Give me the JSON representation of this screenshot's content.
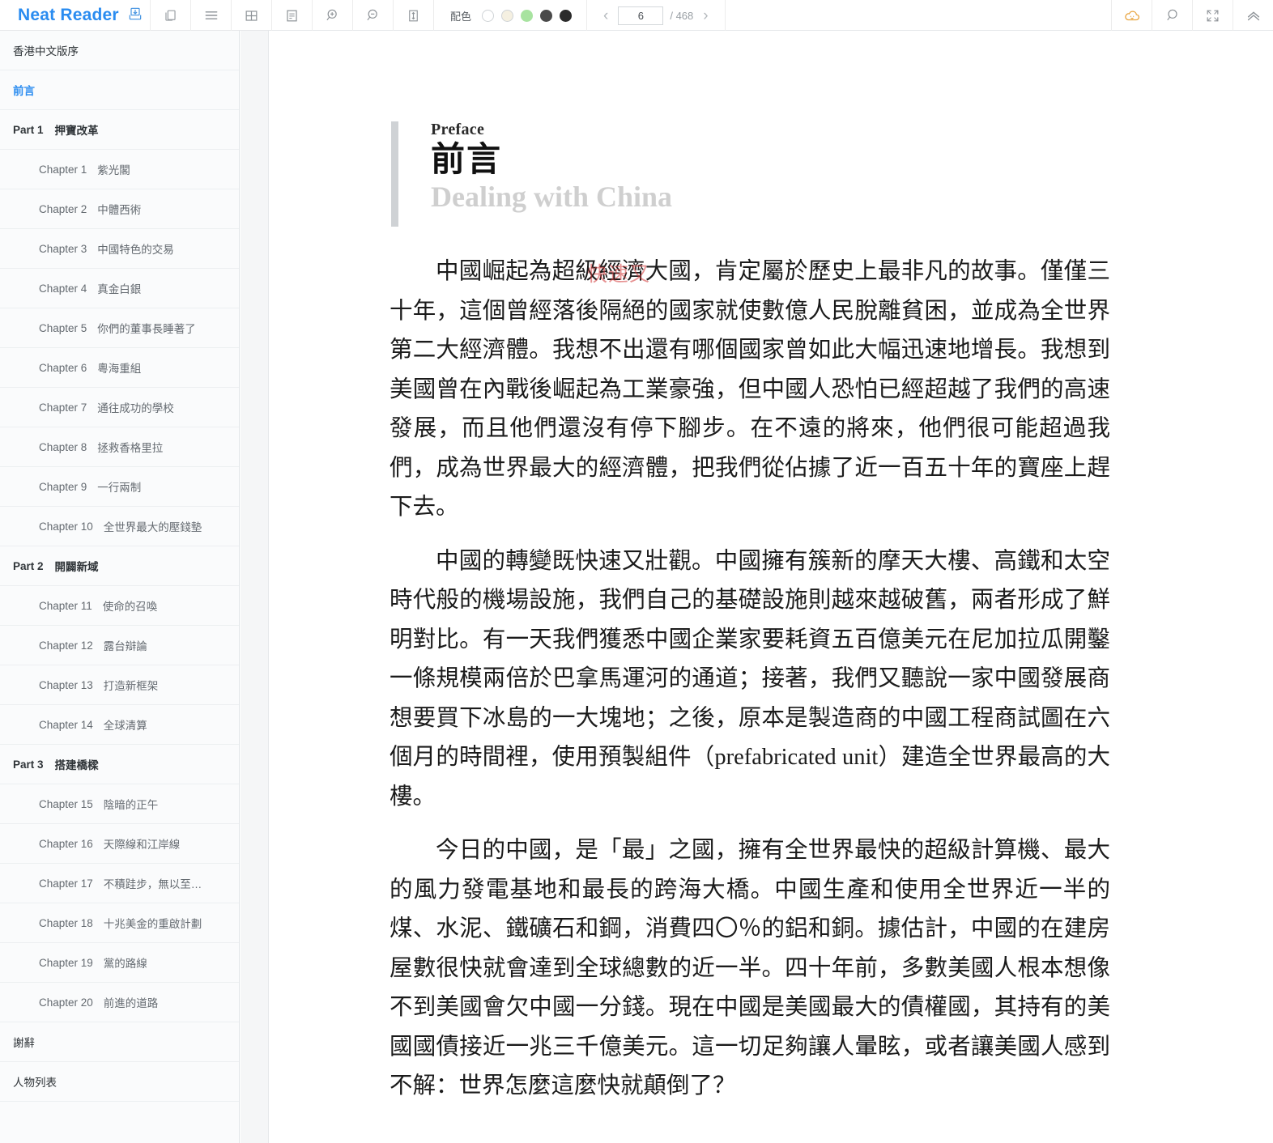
{
  "app": {
    "brand": "Neat Reader"
  },
  "toolbar": {
    "icons": [
      {
        "name": "save-book-icon",
        "glyph": "save"
      },
      {
        "name": "copy-icon",
        "glyph": "copy"
      },
      {
        "name": "menu-icon",
        "glyph": "menu"
      },
      {
        "name": "grid-icon",
        "glyph": "grid"
      },
      {
        "name": "notes-icon",
        "glyph": "notes"
      },
      {
        "name": "zoom-in-icon",
        "glyph": "zoom-in"
      },
      {
        "name": "zoom-out-icon",
        "glyph": "zoom-out"
      },
      {
        "name": "line-height-icon",
        "glyph": "line-height"
      }
    ],
    "colors_label": "配色",
    "swatches": [
      {
        "name": "theme-white",
        "hex": "#ffffff"
      },
      {
        "name": "theme-sepia",
        "hex": "#f5f0e1"
      },
      {
        "name": "theme-green",
        "hex": "#a8e3a0"
      },
      {
        "name": "theme-dark-gray",
        "hex": "#4a4a4a"
      },
      {
        "name": "theme-black",
        "hex": "#2b2b2b"
      }
    ],
    "pager": {
      "prev": "‹",
      "next": "›",
      "current_page": "6",
      "total_label": "/ 468"
    },
    "right_icons": [
      {
        "name": "cloud-sync-icon",
        "glyph": "cloud",
        "hex": "#e8a33d"
      },
      {
        "name": "search-icon",
        "glyph": "search"
      },
      {
        "name": "fullscreen-icon",
        "glyph": "fullscreen"
      },
      {
        "name": "collapse-up-icon",
        "glyph": "chevrons-up"
      }
    ]
  },
  "sidebar": {
    "items": [
      {
        "type": "front",
        "title": "香港中文版序",
        "active": false
      },
      {
        "type": "front",
        "title": "前言",
        "active": true
      },
      {
        "type": "part",
        "num": "Part 1",
        "title": "押寶改革"
      },
      {
        "type": "chapter",
        "num": "Chapter 1",
        "title": "紫光閣"
      },
      {
        "type": "chapter",
        "num": "Chapter 2",
        "title": "中體西術"
      },
      {
        "type": "chapter",
        "num": "Chapter 3",
        "title": "中國特色的交易"
      },
      {
        "type": "chapter",
        "num": "Chapter 4",
        "title": "真金白銀"
      },
      {
        "type": "chapter",
        "num": "Chapter 5",
        "title": "你們的董事長睡著了"
      },
      {
        "type": "chapter",
        "num": "Chapter 6",
        "title": "粵海重組"
      },
      {
        "type": "chapter",
        "num": "Chapter 7",
        "title": "通往成功的學校"
      },
      {
        "type": "chapter",
        "num": "Chapter 8",
        "title": "拯救香格里拉"
      },
      {
        "type": "chapter",
        "num": "Chapter 9",
        "title": "一行兩制"
      },
      {
        "type": "chapter",
        "num": "Chapter 10",
        "title": "全世界最大的壓錢墊"
      },
      {
        "type": "part",
        "num": "Part 2",
        "title": "開闢新域"
      },
      {
        "type": "chapter",
        "num": "Chapter 11",
        "title": "使命的召喚"
      },
      {
        "type": "chapter",
        "num": "Chapter 12",
        "title": "露台辯論"
      },
      {
        "type": "chapter",
        "num": "Chapter 13",
        "title": "打造新框架"
      },
      {
        "type": "chapter",
        "num": "Chapter 14",
        "title": "全球清算"
      },
      {
        "type": "part",
        "num": "Part 3",
        "title": "搭建橋樑"
      },
      {
        "type": "chapter",
        "num": "Chapter 15",
        "title": "陰暗的正午"
      },
      {
        "type": "chapter",
        "num": "Chapter 16",
        "title": "天際線和江岸線"
      },
      {
        "type": "chapter",
        "num": "Chapter 17",
        "title": "不積跬步，無以至…"
      },
      {
        "type": "chapter",
        "num": "Chapter 18",
        "title": "十兆美金的重啟計劃"
      },
      {
        "type": "chapter",
        "num": "Chapter 19",
        "title": "黨的路線"
      },
      {
        "type": "chapter",
        "num": "Chapter 20",
        "title": "前進的道路"
      },
      {
        "type": "front",
        "title": "謝辭",
        "active": false
      },
      {
        "type": "front",
        "title": "人物列表",
        "active": false
      }
    ]
  },
  "content": {
    "kicker": "Preface",
    "title_cn": "前言",
    "title_en": "Dealing with China",
    "watermark": "快速又",
    "paragraphs": [
      "中國崛起為超級經濟大國，肯定屬於歷史上最非凡的故事。僅僅三十年，這個曾經落後隔絕的國家就使數億人民脫離貧困，並成為全世界第二大經濟體。我想不出還有哪個國家曾如此大幅迅速地增長。我想到美國曾在內戰後崛起為工業豪強，但中國人恐怕已經超越了我們的高速發展，而且他們還沒有停下腳步。在不遠的將來，他們很可能超過我們，成為世界最大的經濟體，把我們從佔據了近一百五十年的寶座上趕下去。",
      "中國的轉變既快速又壯觀。中國擁有簇新的摩天大樓、高鐵和太空時代般的機場設施，我們自己的基礎設施則越來越破舊，兩者形成了鮮明對比。有一天我們獲悉中國企業家要耗資五百億美元在尼加拉瓜開鑿一條規模兩倍於巴拿馬運河的通道；接著，我們又聽說一家中國發展商想要買下冰島的一大塊地；之後，原本是製造商的中國工程商試圖在六個月的時間裡，使用預製組件（prefabricated unit）建造全世界最高的大樓。",
      "今日的中國，是「最」之國，擁有全世界最快的超級計算機、最大的風力發電基地和最長的跨海大橋。中國生產和使用全世界近一半的煤、水泥、鐵礦石和鋼，消費四〇％的鋁和銅。據估計，中國的在建房屋數很快就會達到全球總數的近一半。四十年前，多數美國人根本想像不到美國會欠中國一分錢。現在中國是美國最大的債權國，其持有的美國國債接近一兆三千億美元。這一切足夠讓人暈眩，或者讓美國人感到不解：世界怎麼這麼快就顛倒了？"
    ]
  }
}
